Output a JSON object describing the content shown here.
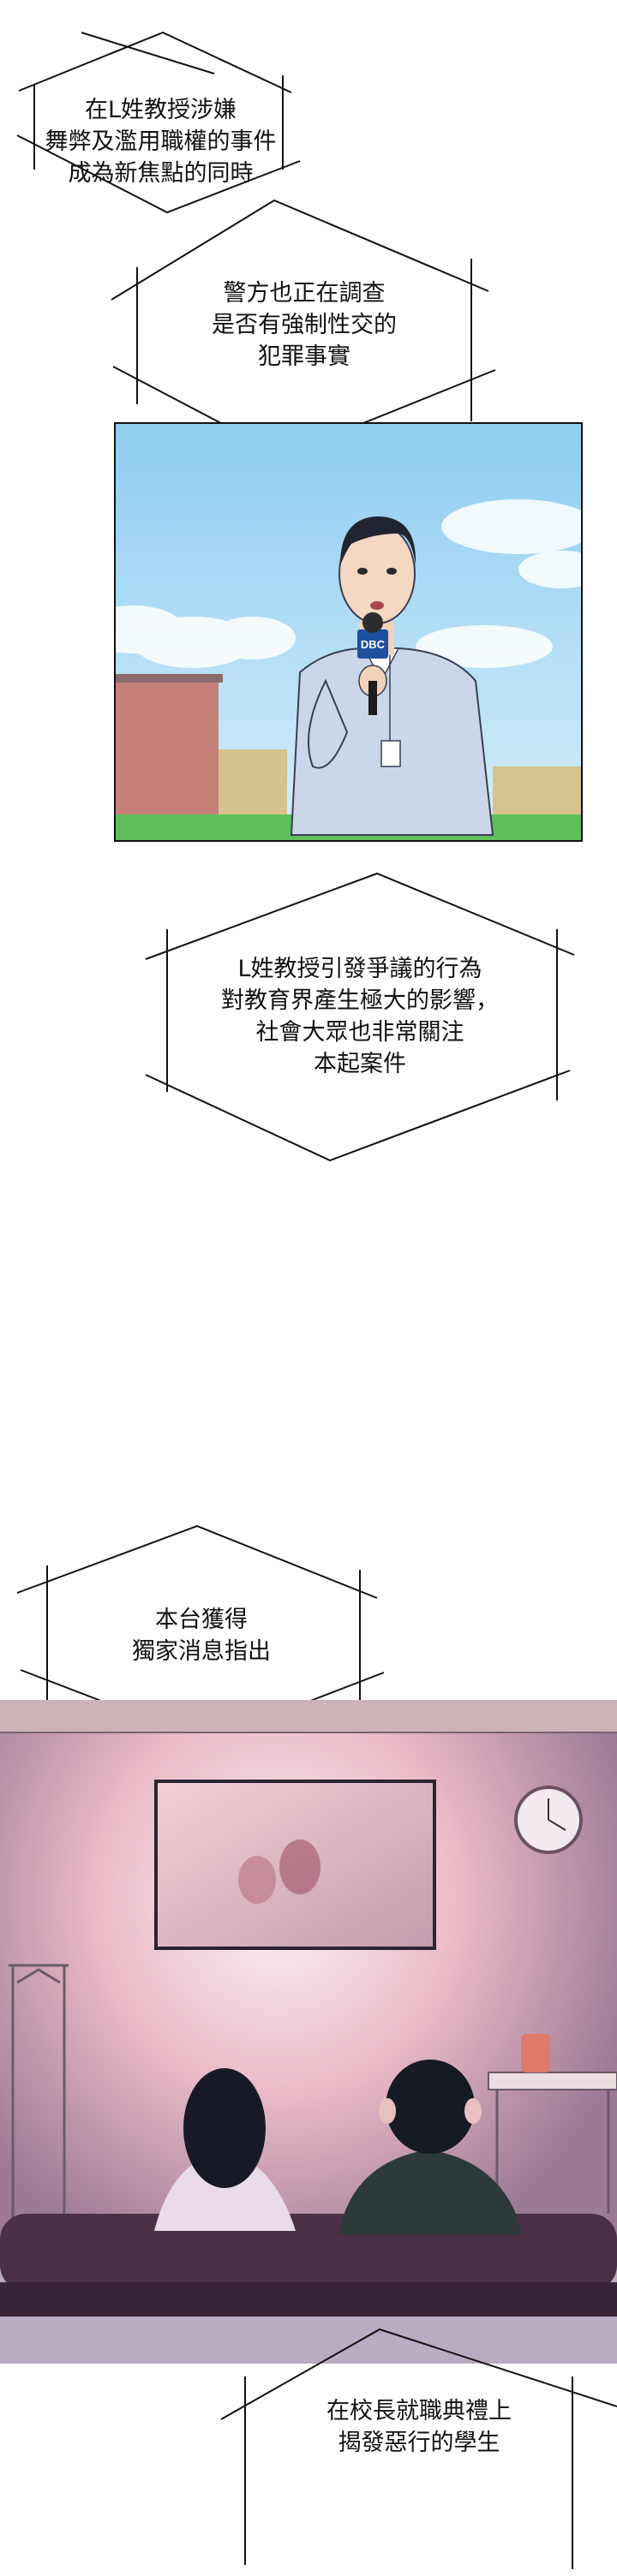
{
  "captions": [
    {
      "id": "c1",
      "lines": [
        "在L姓教授涉嫌",
        "舞弊及濫用職權的事件",
        "成為新焦點的同時"
      ]
    },
    {
      "id": "c2",
      "lines": [
        "警方也正在調查",
        "是否有強制性交的",
        "犯罪事實"
      ]
    },
    {
      "id": "c3",
      "lines": [
        "L姓教授引發爭議的行為",
        "對教育界產生極大的影響，",
        "社會大眾也非常關注",
        "本起案件"
      ]
    },
    {
      "id": "c4",
      "lines": [
        "本台獲得",
        "獨家消息指出"
      ]
    },
    {
      "id": "c5",
      "lines": [
        "在校長就職典禮上",
        "揭發惡行的學生"
      ]
    }
  ],
  "panel_reporter": {
    "mic_logo": "DBC"
  },
  "colors": {
    "outline": "#111111",
    "sky": "#a9d8f2",
    "wall_pink": "#e7b7c2",
    "sofa": "#4b2f45"
  }
}
